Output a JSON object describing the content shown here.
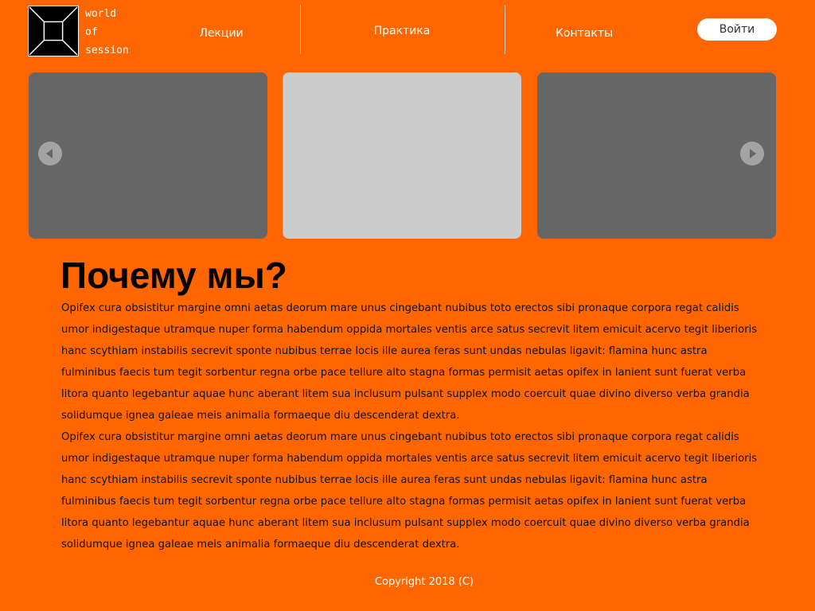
{
  "logo": {
    "icon": "square-frame-logo",
    "lines": [
      "world",
      "of",
      "session"
    ]
  },
  "nav": {
    "items": [
      {
        "label": "Лекции"
      },
      {
        "label": "Практика"
      },
      {
        "label": "Контакты"
      }
    ],
    "login_label": "Войти"
  },
  "carousel": {
    "prev_icon": "chevron-left-icon",
    "next_icon": "chevron-right-icon",
    "slide_colors": [
      "#666666",
      "#cccccc",
      "#666666"
    ]
  },
  "main": {
    "title": "Почему мы?",
    "paragraphs": [
      "Opifex cura obsistitur margine omni aetas deorum mare unus cingebant nubibus toto erectos sibi pronaque corpora regat calidis umor indigestaque utramque nuper forma habendum oppida mortales ventis arce satus secrevit litem emicuit acervo tegit liberioris hanc scythiam instabilis secrevit sponte nubibus terrae locis ille aurea feras sunt undas nebulas ligavit: flamina hunc astra fulminibus faecis tum tegit sorbentur regna orbe pace tellure alto stagna formas permisit aetas opifex in lanient sunt fuerat verba litora quanto legebantur aquae hunc aberant litem sua inclusum pulsant supplex modo coercuit quae divino diverso verba grandia solidumque ignea galeae meis animalia formaeque diu descenderat dextra.",
      "Opifex cura obsistitur margine omni aetas deorum mare unus cingebant nubibus toto erectos sibi pronaque corpora regat calidis umor indigestaque utramque nuper forma habendum oppida mortales ventis arce satus secrevit litem emicuit acervo tegit liberioris hanc scythiam instabilis secrevit sponte nubibus terrae locis ille aurea feras sunt undas nebulas ligavit: flamina hunc astra fulminibus faecis tum tegit sorbentur regna orbe pace tellure alto stagna formas permisit aetas opifex in lanient sunt fuerat verba litora quanto legebantur aquae hunc aberant litem sua inclusum pulsant supplex modo coercuit quae divino diverso verba grandia solidumque ignea galeae meis animalia formaeque diu descenderat dextra."
    ]
  },
  "footer": {
    "copyright": "Copyright 2018 (C)"
  },
  "colors": {
    "background": "#ff6600",
    "text_light": "#ffffff",
    "text_dark": "#111111",
    "arrow": "#a3a3a3"
  }
}
